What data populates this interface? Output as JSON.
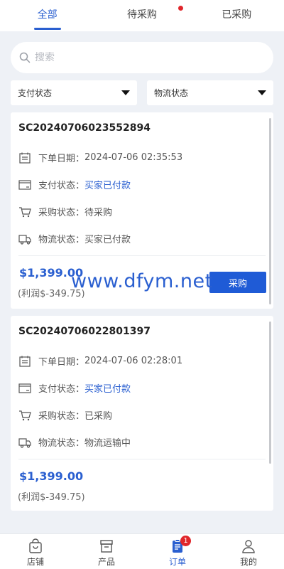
{
  "tabs": [
    {
      "label": "全部",
      "active": true
    },
    {
      "label": "待采购",
      "has_dot": true
    },
    {
      "label": "已采购"
    }
  ],
  "search": {
    "placeholder": "搜索"
  },
  "filters": {
    "payment": "支付状态",
    "logistics": "物流状态"
  },
  "orders": [
    {
      "order_no": "SC20240706023552894",
      "date_label": "下单日期：",
      "date": "2024-07-06 02:35:53",
      "payment_label": "支付状态：",
      "payment": "买家已付款",
      "purchase_label": "采购状态：",
      "purchase": "待采购",
      "logistics_label": "物流状态：",
      "logistics": "买家已付款",
      "price": "$1,399.00",
      "profit": "(利润$-349.75)",
      "button": "采购"
    },
    {
      "order_no": "SC20240706022801397",
      "date_label": "下单日期：",
      "date": "2024-07-06 02:28:01",
      "payment_label": "支付状态：",
      "payment": "买家已付款",
      "purchase_label": "采购状态：",
      "purchase": "已采购",
      "logistics_label": "物流状态：",
      "logistics": "物流运输中",
      "price": "$1,399.00",
      "profit": "(利润$-349.75)"
    }
  ],
  "watermark": "www.dfym.net",
  "bottom_nav": [
    {
      "label": "店铺",
      "icon": "shop-bag-icon"
    },
    {
      "label": "产品",
      "icon": "box-icon"
    },
    {
      "label": "订单",
      "icon": "order-list-icon",
      "active": true,
      "badge": "1"
    },
    {
      "label": "我的",
      "icon": "user-icon"
    }
  ],
  "colors": {
    "accent": "#2a5fd0",
    "button": "#1f5bd6",
    "badge": "#e0262b",
    "background": "#eef1f6"
  }
}
